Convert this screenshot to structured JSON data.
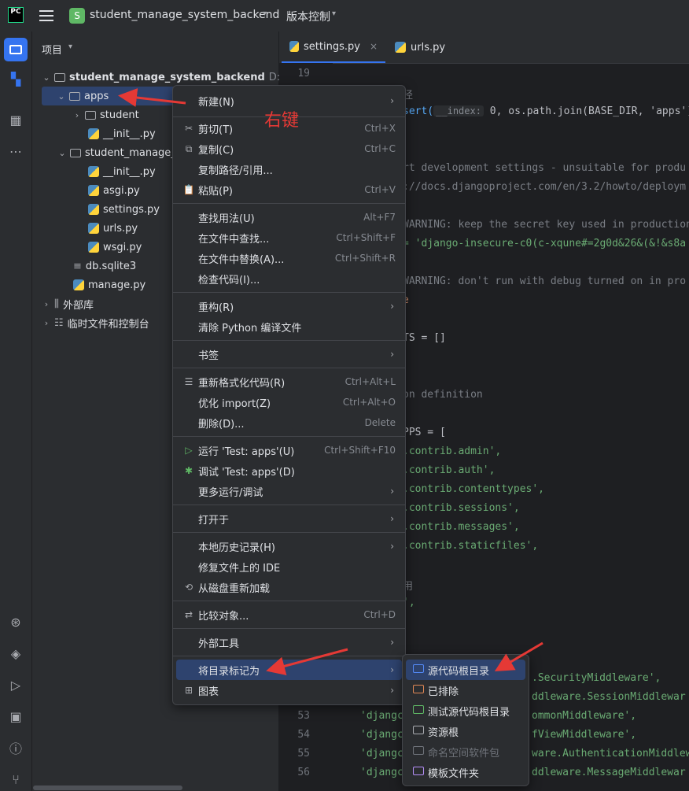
{
  "titlebar": {
    "logo": "PC",
    "project_badge": "S",
    "project_name": "student_manage_system_backend",
    "vcs_label": "版本控制"
  },
  "project_panel": {
    "title": "项目",
    "root": "student_manage_system_backend",
    "root_path": "D:\\Dev",
    "items": {
      "apps": "apps",
      "student": "student",
      "init1": "__init__.py",
      "pkg": "student_manage_",
      "init2": "__init__.py",
      "asgi": "asgi.py",
      "settings": "settings.py",
      "urls": "urls.py",
      "wsgi": "wsgi.py",
      "db": "db.sqlite3",
      "manage": "manage.py",
      "ext": "外部库",
      "scratch": "临时文件和控制台"
    }
  },
  "tabs": {
    "settings": "settings.py",
    "urls": "urls.py"
  },
  "annotation": "右键",
  "code": {
    "line19": "19",
    "l1": "径",
    "l2a": "sert(",
    "l2hint": "__index:",
    "l2b": " 0, os.path.join(BASE_DIR, 'apps'))",
    "l3": "rt development settings - unsuitable for produ",
    "l4": "://docs.djangoproject.com/en/3.2/howto/deploym",
    "l5": "WARNING: keep the secret key used in production",
    "l6": "= 'django-insecure-c0(c-xqune#=2g0d&26&(&!&s8a",
    "l7": "WARNING: don't run with debug turned on in pro",
    "l8": "e",
    "l9": "TS = []",
    "l10": "on definition",
    "l11": "PPS = [",
    "l12": ".contrib.admin',",
    "l13": ".contrib.auth',",
    "l14": ".contrib.contenttypes',",
    "l15": ".contrib.sessions',",
    "l16": ".contrib.messages',",
    "l17": ".contrib.staticfiles',",
    "l18": "用",
    "l19": "',",
    "l20": ".SecurityMiddleware',",
    "l21": "ddleware.SessionMiddlewar",
    "l22": "'djangc",
    "l22b": "ommonMiddleware',",
    "l23": "'djangc",
    "l23b": "fViewMiddleware',",
    "l24": "'djangc",
    "l24b": "ware.AuthenticationMiddlew",
    "l25": "'djangc",
    "l25b": "ddleware.MessageMiddlewar",
    "n53": "53",
    "n54": "54",
    "n55": "55",
    "n56": "56"
  },
  "context_menu": {
    "new": "新建(N)",
    "cut": "剪切(T)",
    "cut_sc": "Ctrl+X",
    "copy": "复制(C)",
    "copy_sc": "Ctrl+C",
    "copy_path": "复制路径/引用...",
    "paste": "粘贴(P)",
    "paste_sc": "Ctrl+V",
    "find_usages": "查找用法(U)",
    "find_usages_sc": "Alt+F7",
    "find_in_files": "在文件中查找...",
    "find_in_files_sc": "Ctrl+Shift+F",
    "replace_in_files": "在文件中替换(A)...",
    "replace_in_files_sc": "Ctrl+Shift+R",
    "inspect": "检查代码(I)...",
    "refactor": "重构(R)",
    "clean_py": "清除 Python 编译文件",
    "bookmarks": "书签",
    "reformat": "重新格式化代码(R)",
    "reformat_sc": "Ctrl+Alt+L",
    "optimize": "优化 import(Z)",
    "optimize_sc": "Ctrl+Alt+O",
    "delete": "删除(D)...",
    "delete_sc": "Delete",
    "run": "运行 'Test: apps'(U)",
    "run_sc": "Ctrl+Shift+F10",
    "debug": "调试 'Test: apps'(D)",
    "more_run": "更多运行/调试",
    "open_in": "打开于",
    "local_history": "本地历史记录(H)",
    "repair_ide": "修复文件上的 IDE",
    "reload": "从磁盘重新加载",
    "compare": "比较对象...",
    "compare_sc": "Ctrl+D",
    "external_tools": "外部工具",
    "mark_dir": "将目录标记为",
    "diagrams": "图表"
  },
  "submenu": {
    "sources_root": "源代码根目录",
    "excluded": "已排除",
    "test_sources": "测试源代码根目录",
    "resources": "资源根",
    "namespace": "命名空间软件包",
    "templates": "模板文件夹"
  },
  "colors": {
    "accent": "#3574f0",
    "arrow": "#e53935",
    "string": "#6aab73",
    "keyword": "#cf8e6d",
    "comment": "#7a7e85"
  }
}
